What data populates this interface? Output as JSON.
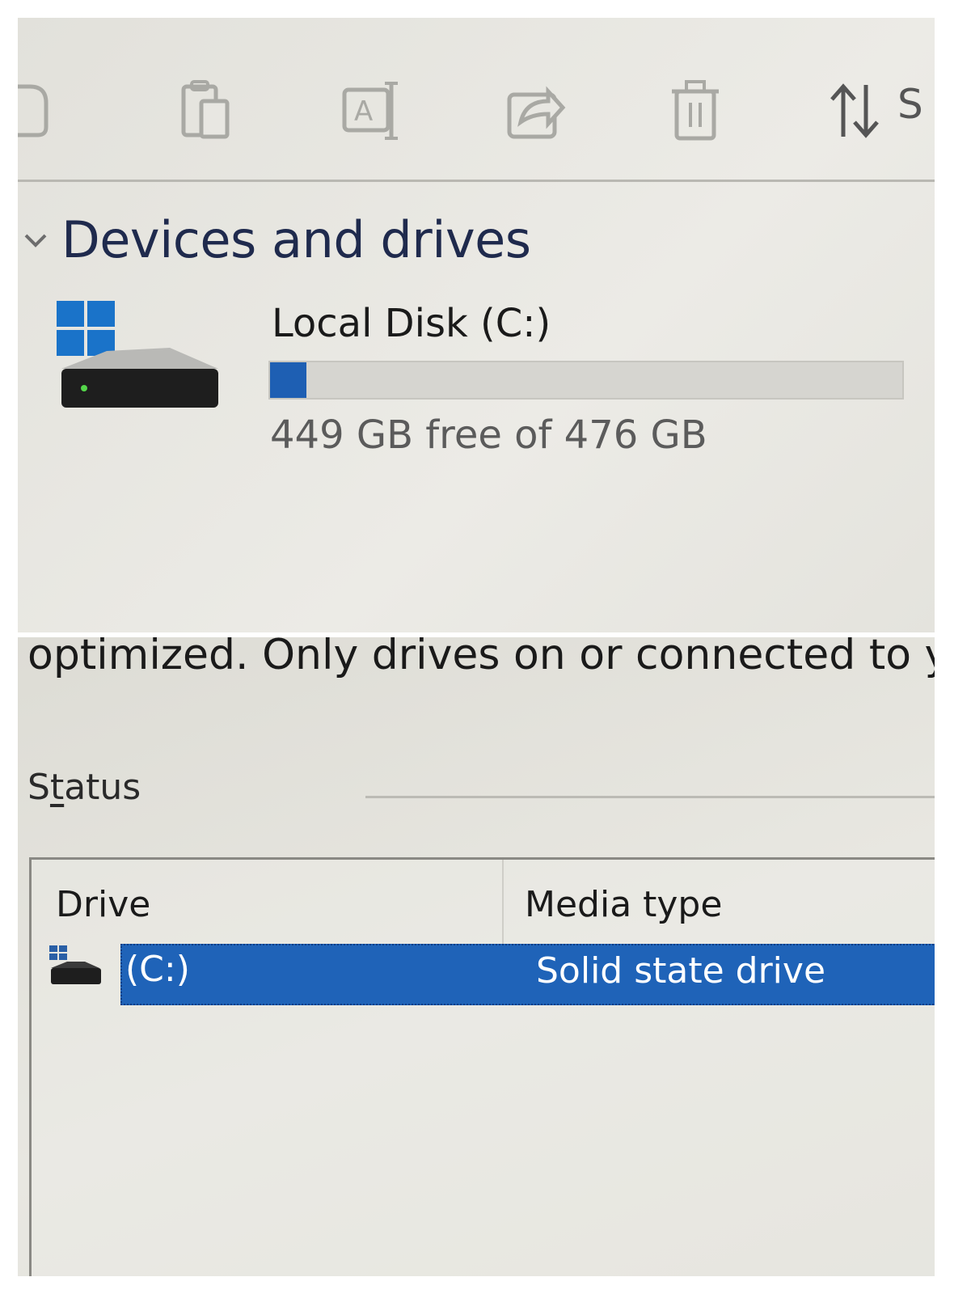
{
  "toolbar": {
    "buttons": [
      {
        "name": "new-icon"
      },
      {
        "name": "paste-icon"
      },
      {
        "name": "rename-icon"
      },
      {
        "name": "share-icon"
      },
      {
        "name": "delete-icon"
      },
      {
        "name": "sort-icon"
      }
    ],
    "sort_label": "S"
  },
  "devices": {
    "section_title": "Devices and drives",
    "drives": [
      {
        "name": "Local Disk (C:)",
        "free_text": "449 GB free of 476 GB",
        "used_fraction": 0.057,
        "icon": "windows-drive-icon"
      }
    ]
  },
  "optimize": {
    "description": "optimized. Only drives on or connected to your c",
    "status_label": "Status",
    "columns": {
      "drive": "Drive",
      "media_type": "Media type"
    },
    "rows": [
      {
        "drive": "(C:)",
        "media_type": "Solid state drive",
        "selected": true
      }
    ]
  },
  "colors": {
    "accent": "#1e5fb3",
    "selection": "#1f63b8",
    "section_title": "#1f2a4d"
  }
}
